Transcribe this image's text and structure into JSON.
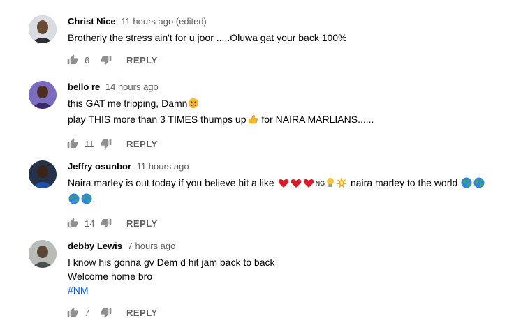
{
  "comments": [
    {
      "author": "Christ Nice",
      "time": "11 hours ago (edited)",
      "text": [
        "Brotherly  the stress  ain't for u joor .....Oluwa gat your back 100%"
      ],
      "likes": "6",
      "reply_label": "REPLY",
      "avatar_color": "#c9cdd2"
    },
    {
      "author": "bello re",
      "time": "14 hours ago",
      "text": [
        "this GAT me tripping, Damn",
        " play THIS more than 3 TIMES thumps up",
        " for NAIRA MARLIANS......"
      ],
      "likes": "11",
      "reply_label": "REPLY",
      "avatar_color": "#5b4a8a"
    },
    {
      "author": "Jeffry osunbor",
      "time": "11 hours ago",
      "text": [
        "Naira marley is out today if you believe hit a like",
        "NG",
        " naira marley to the world"
      ],
      "likes": "14",
      "reply_label": "REPLY",
      "avatar_color": "#1f3f7a"
    },
    {
      "author": "debby Lewis",
      "time": "7 hours ago",
      "text": [
        "I know his gonna gv Dem d hit jam back to back",
        "Welcome home bro",
        "#NM"
      ],
      "likes": "7",
      "reply_label": "REPLY",
      "avatar_color": "#8a8f8c"
    }
  ],
  "icons": {
    "like": "thumb-up-icon",
    "dislike": "thumb-down-icon"
  }
}
